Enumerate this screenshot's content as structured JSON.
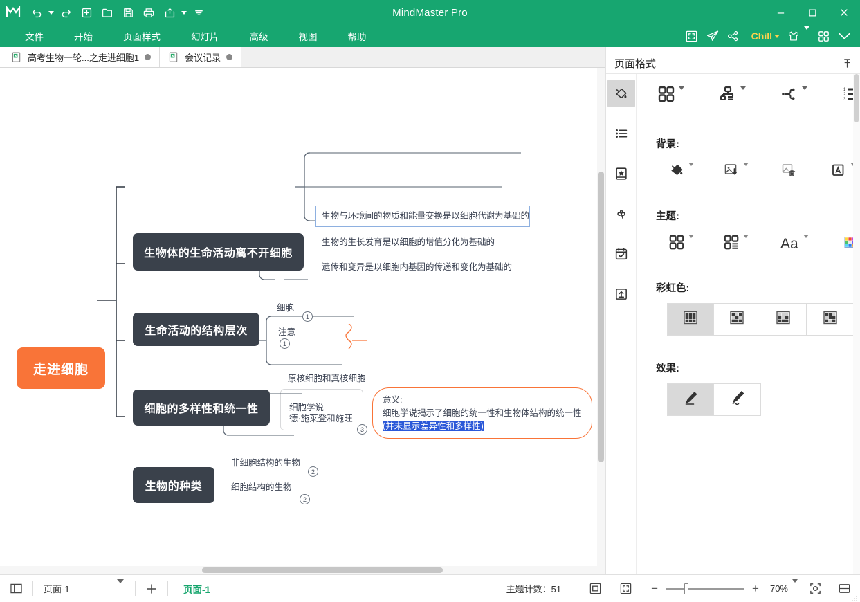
{
  "titlebar": {
    "app_title": "MindMaster Pro",
    "logo_icon": "mindmaster-logo-icon",
    "quick_access": [
      {
        "name": "undo",
        "icon": "undo-icon",
        "has_caret": true
      },
      {
        "name": "redo",
        "icon": "redo-icon",
        "has_caret": false
      },
      {
        "name": "new",
        "icon": "new-file-icon",
        "has_caret": false
      },
      {
        "name": "open",
        "icon": "open-folder-icon",
        "has_caret": false
      },
      {
        "name": "save",
        "icon": "save-disk-icon",
        "has_caret": false
      },
      {
        "name": "print",
        "icon": "print-icon",
        "has_caret": false
      },
      {
        "name": "export",
        "icon": "export-share-icon",
        "has_caret": true
      },
      {
        "name": "more",
        "icon": "more-caret-icon",
        "has_caret": false
      }
    ],
    "window_controls": {
      "minimize": "minimize-icon",
      "maximize": "maximize-icon",
      "close": "close-icon"
    }
  },
  "menubar": {
    "items": [
      {
        "label": "文件"
      },
      {
        "label": "开始"
      },
      {
        "label": "页面样式"
      },
      {
        "label": "幻灯片"
      },
      {
        "label": "高级"
      },
      {
        "label": "视图"
      },
      {
        "label": "帮助"
      }
    ],
    "right_tools": [
      {
        "name": "fullscreen",
        "icon": "fullscreen-icon"
      },
      {
        "name": "send",
        "icon": "paper-plane-icon"
      },
      {
        "name": "share",
        "icon": "share-nodes-icon"
      }
    ],
    "account_label": "Chill",
    "skin_icon": "shirt-icon",
    "apps_icon": "grid-apps-icon",
    "collapse_icon": "chevron-double-down-icon"
  },
  "doc_tabs": [
    {
      "label": "高考生物一轮...之走进细胞1",
      "icon": "document-icon",
      "active": true,
      "modified": true
    },
    {
      "label": "会议记录",
      "icon": "document-icon",
      "active": false,
      "modified": true
    }
  ],
  "mindmap": {
    "root": {
      "label": "走进细胞",
      "color": "#f97438"
    },
    "branches": [
      {
        "label": "生物体的生命活动离不开细胞",
        "children": [
          {
            "label": "生物与环境间的物质和能量交换是以细胞代谢为基础的",
            "selected": true
          },
          {
            "label": "生物的生长发育是以细胞的增值分化为基础的",
            "selected": false
          },
          {
            "label": "遗传和变异是以细胞内基因的传递和变化为基础的",
            "selected": false
          }
        ]
      },
      {
        "label": "生命活动的结构层次",
        "children": [
          {
            "label": "细胞",
            "badge": "1"
          },
          {
            "label": "注意",
            "badge": "1"
          }
        ]
      },
      {
        "label": "细胞的多样性和统一性",
        "children": [
          {
            "label": "原核细胞和真核细胞",
            "badge": ""
          },
          {
            "label": "细胞学说",
            "label2": "德·施莱登和施旺",
            "badge": "3"
          }
        ],
        "callout": {
          "line1": "意义:",
          "line2": "细胞学说揭示了细胞的统一性和生物体结构的统一性",
          "line3": "(并未显示差异性和多样性)",
          "line3_highlighted": true,
          "border_color": "#f97438"
        }
      },
      {
        "label": "生物的种类",
        "children": [
          {
            "label": "非细胞结构的生物",
            "badge": "2"
          },
          {
            "label": "细胞结构的生物",
            "badge": "2"
          }
        ]
      }
    ]
  },
  "right_panel": {
    "title": "页面格式",
    "pin_icon": "pin-icon",
    "rail": [
      {
        "name": "style",
        "icon": "paint-bucket-icon",
        "active": true
      },
      {
        "name": "outline",
        "icon": "bullet-list-icon",
        "active": false
      },
      {
        "name": "clipart",
        "icon": "sticker-star-icon",
        "active": false
      },
      {
        "name": "clover",
        "icon": "clover-icon",
        "active": false
      },
      {
        "name": "task",
        "icon": "calendar-check-icon",
        "active": false
      },
      {
        "name": "upload",
        "icon": "upload-box-icon",
        "active": false
      }
    ],
    "top_tools": [
      {
        "name": "layout-structure",
        "icon": "grid-four-icon"
      },
      {
        "name": "org-structure",
        "icon": "org-tree-icon"
      },
      {
        "name": "branch-style",
        "icon": "branch-connector-icon"
      },
      {
        "name": "numbering",
        "icon": "numbered-list-icon"
      }
    ],
    "sections": [
      {
        "title": "背景:",
        "tools": [
          {
            "name": "fill-color",
            "icon": "paint-bucket-icon"
          },
          {
            "name": "background-image",
            "icon": "image-insert-icon"
          },
          {
            "name": "remove-background-image",
            "icon": "image-delete-icon"
          },
          {
            "name": "watermark",
            "icon": "letter-a-box-icon"
          }
        ]
      },
      {
        "title": "主题:",
        "tools": [
          {
            "name": "theme-style",
            "icon": "grid-four-icon"
          },
          {
            "name": "theme-layout",
            "icon": "grid-list-icon"
          },
          {
            "name": "theme-font",
            "icon": "font-Aa-icon"
          },
          {
            "name": "theme-colors",
            "icon": "color-palette-icon"
          }
        ]
      }
    ],
    "rainbow": {
      "title": "彩虹色:",
      "options": [
        {
          "name": "rainbow-option-1",
          "icon": "swatch-grid-uniform-icon",
          "active": true
        },
        {
          "name": "rainbow-option-2",
          "icon": "swatch-grid-mixed-a-icon",
          "active": false
        },
        {
          "name": "rainbow-option-3",
          "icon": "swatch-grid-mixed-b-icon",
          "active": false
        },
        {
          "name": "rainbow-option-4",
          "icon": "swatch-grid-mixed-c-icon",
          "active": false
        }
      ]
    },
    "effects": {
      "title": "效果:",
      "options": [
        {
          "name": "effect-straight-pen",
          "icon": "pen-straight-icon",
          "active": true
        },
        {
          "name": "effect-hand-drawn",
          "icon": "pen-wavy-icon",
          "active": false
        }
      ]
    }
  },
  "statusbar": {
    "outline_icon": "panel-toggle-icon",
    "page_select_value": "页面-1",
    "add_page_icon": "plus-icon",
    "page_tab_label": "页面-1",
    "topic_count_label": "主题计数：",
    "topic_count_value": "51",
    "fit_icon": "fit-page-icon",
    "expand_icon": "fit-screen-icon",
    "zoom_out": "−",
    "zoom_in": "+",
    "zoom_value": "70%",
    "zoom_caret": "caret-down-icon",
    "focus_icon": "focus-center-icon",
    "split_icon": "split-view-icon"
  },
  "colors": {
    "brand_green": "#17a670",
    "accent_orange": "#f97438",
    "node_dark": "#3a414b",
    "account_yellow": "#ffd24d",
    "selection_blue": "#2b58d8",
    "page_tab_green": "#18a66e"
  }
}
